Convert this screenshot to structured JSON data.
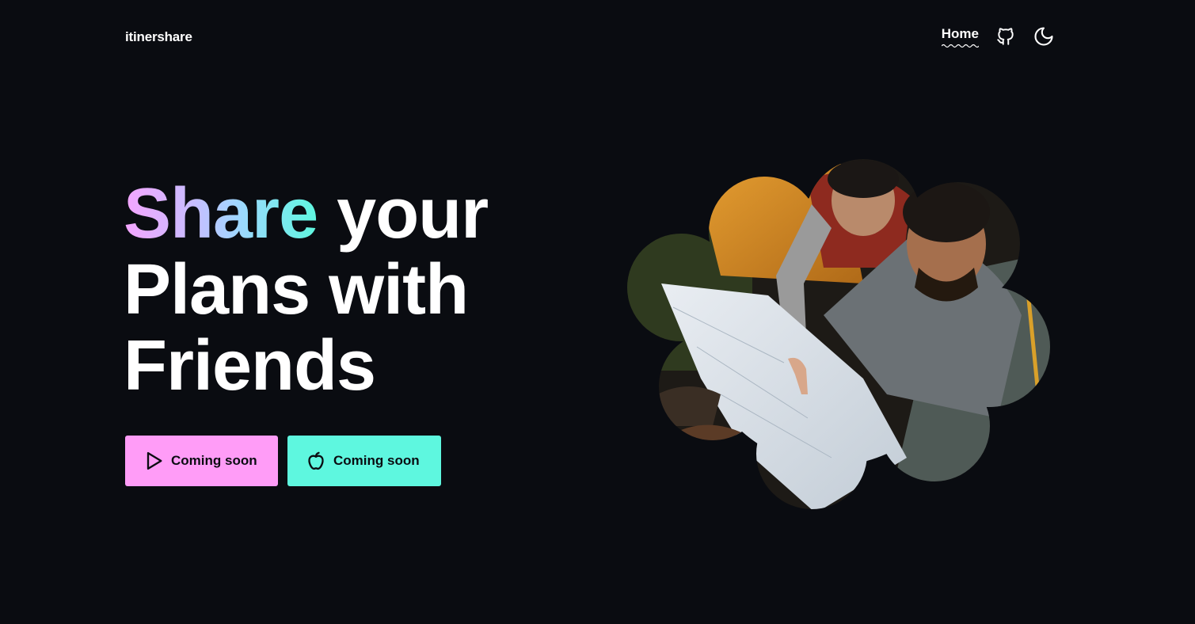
{
  "header": {
    "brand": "itinershare",
    "nav": {
      "home_label": "Home",
      "github_icon": "github-icon",
      "theme_icon": "moon-icon"
    }
  },
  "hero": {
    "headline_highlight": "Share",
    "headline_rest_line1": " your",
    "headline_line2": "Plans with",
    "headline_line3": "Friends",
    "buttons": [
      {
        "label": "Coming soon",
        "icon": "play-icon",
        "color": "#ff9cf7"
      },
      {
        "label": "Coming soon",
        "icon": "apple-icon",
        "color": "#5ef7df"
      }
    ],
    "image_subject": "two people reading a map in front of a tent"
  },
  "colors": {
    "background": "#0a0c11",
    "accent_pink": "#ff9cf7",
    "accent_teal": "#5ef7df"
  }
}
